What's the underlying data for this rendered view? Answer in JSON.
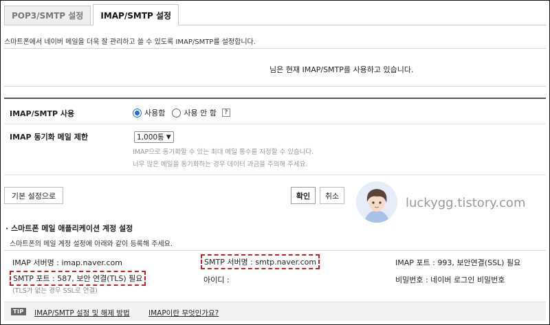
{
  "tabs": [
    {
      "label": "POP3/SMTP 설정",
      "active": false
    },
    {
      "label": "IMAP/SMTP 설정",
      "active": true
    }
  ],
  "description": "스마트폰에서 네이버 메일을 더욱 잘 관리하고 쓸 수 있도록 IMAP/SMTP를 설정합니다.",
  "status_text": "님은 현재 IMAP/SMTP를 사용하고 있습니다.",
  "imap_smtp_use": {
    "label": "IMAP/SMTP 사용",
    "options": [
      {
        "label": "사용함",
        "checked": true
      },
      {
        "label": "사용 안 함",
        "checked": false
      }
    ],
    "help_label": "?"
  },
  "sync_limit": {
    "label": "IMAP 동기화 메일 제한",
    "selected": "1,000통",
    "hint_line1": "IMAP으로 동기화할 수 있는 최대 메일 통수를 지정할 수 있습니다.",
    "hint_line2": "너무 많은 메일을 동기화하는 경우 데이터 과금을 주의해 주세요."
  },
  "buttons": {
    "reset": "기본 설정으로",
    "confirm": "확인",
    "cancel": "취소"
  },
  "watermark": "luckygg.tistory.com",
  "app_settings": {
    "title": "스마트폰 메일 애플리케이션 계정 설정",
    "desc": "스마트폰의 메일 계정 설정에 아래와 같이 등록해 주세요.",
    "imap_server": "IMAP 서버명 : imap.naver.com",
    "smtp_server": "SMTP 서버명 : smtp.naver.com",
    "imap_port": "IMAP 포트 : 993, 보안연결(SSL) 필요",
    "smtp_port": "SMTP 포트 : 587, 보안 연결(TLS) 필요",
    "user_id": "아이디 :",
    "password": "비밀번호 : 네이버 로그인 비밀번호",
    "note": "(TLS가 없는 경우 SSL로 연결)"
  },
  "tip": {
    "badge": "TIP",
    "link1": "IMAP/SMTP 설정 및 해제 방법",
    "link2": "IMAP이란 무엇인가요?"
  },
  "colors": {
    "accent": "#1a6fe0",
    "highlight_border": "#cc1d1d"
  }
}
